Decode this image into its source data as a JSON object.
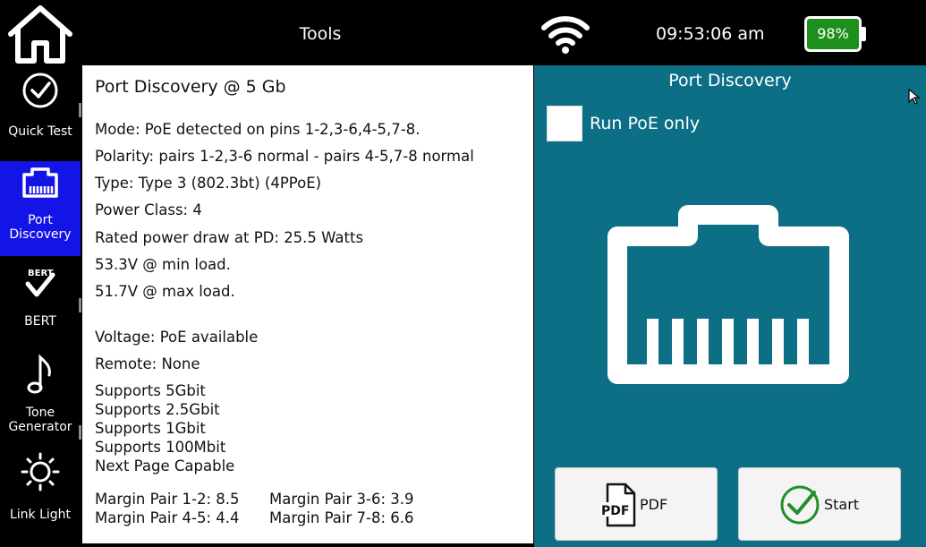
{
  "topbar": {
    "title": "Tools",
    "time": "09:53:06 am",
    "battery_percent": "98%",
    "battery_color": "#1e8f1c"
  },
  "sidebar": {
    "items": [
      {
        "label_line1": "Quick Test",
        "label_line2": "",
        "icon": "check-circle-icon",
        "active": false
      },
      {
        "label_line1": "Port",
        "label_line2": "Discovery",
        "icon": "ethernet-port-icon",
        "active": true
      },
      {
        "label_line1": "BERT",
        "label_line2": "",
        "icon": "bert-icon",
        "active": false
      },
      {
        "label_line1": "Tone",
        "label_line2": "Generator",
        "icon": "music-note-icon",
        "active": false
      },
      {
        "label_line1": "Link Light",
        "label_line2": "",
        "icon": "sun-icon",
        "active": false
      }
    ],
    "active_color": "#1414e6"
  },
  "results": {
    "heading": "Port Discovery @ 5 Gb",
    "mode": "Mode: PoE detected on pins 1-2,3-6,4-5,7-8.",
    "polarity": "Polarity: pairs 1-2,3-6 normal - pairs 4-5,7-8 normal",
    "type": "Type: Type 3 (802.3bt) (4PPoE)",
    "power_class": "Power Class: 4",
    "rated_power": "Rated power draw at PD: 25.5 Watts",
    "min_load": "53.3V @ min load.",
    "max_load": "51.7V @ max load.",
    "voltage": "Voltage: PoE available",
    "remote": "Remote: None",
    "supports": [
      "Supports 5Gbit",
      "Supports 2.5Gbit",
      "Supports 1Gbit",
      "Supports 100Mbit",
      "Next Page Capable"
    ],
    "margins": {
      "pair_1_2": "Margin Pair 1-2: 8.5",
      "pair_3_6": "Margin Pair 3-6: 3.9",
      "pair_4_5": "Margin Pair 4-5: 4.4",
      "pair_7_8": "Margin Pair 7-8: 6.6"
    }
  },
  "right_pane": {
    "title": "Port Discovery",
    "checkbox_label": "Run PoE only",
    "checkbox_checked": false,
    "background_color": "#0d6f86",
    "pdf_button_label": "PDF",
    "pdf_icon_text": "PDF",
    "start_button_label": "Start",
    "start_icon_color": "#1f8f2a"
  }
}
